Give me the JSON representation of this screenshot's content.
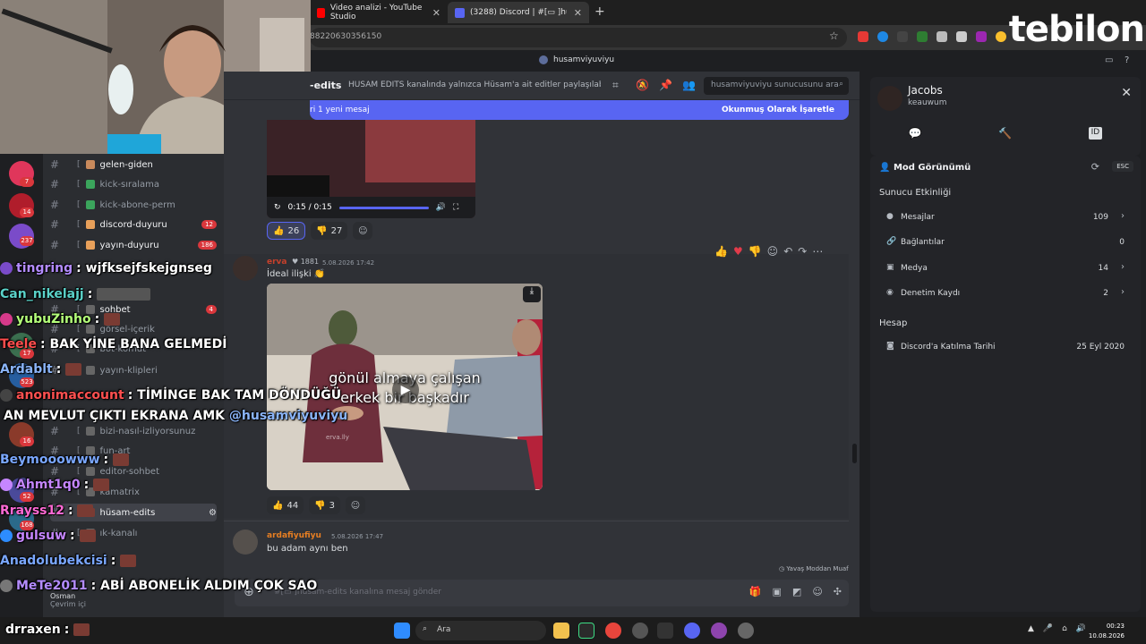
{
  "browser": {
    "tabs": [
      {
        "title": "Video analizi - YouTube Studio",
        "active": false
      },
      {
        "title": "(3288) Discord | #[▭ ]hüsam-e",
        "active": true
      }
    ],
    "url": "88220630356150",
    "logo": "tebilon"
  },
  "discord": {
    "server_name": "husamviyuviyu",
    "channel": {
      "name": "-edits",
      "topic": "HÜSAM EDİTS kanalında yalnızca Hüsam'a ait editler paylaşılabilir. H...",
      "search_placeholder": "husamviyuviyu sunucusunu ara"
    },
    "new_message_bar": {
      "left": "ri 1 yeni mesaj",
      "right": "Okunmuş Olarak İşaretle"
    },
    "video1": {
      "time": "0:15 / 0:15",
      "reactions": [
        {
          "emoji": "👍",
          "count": "26"
        },
        {
          "emoji": "👎",
          "count": "27"
        }
      ]
    },
    "message1": {
      "author": "erva",
      "pill": "1881",
      "timestamp": "5.08.2026 17:42",
      "text": "İdeal ilişki 👏",
      "video_caption_line1": "gönül almaya çalışan",
      "video_caption_line2": "erkek bir başkadır",
      "watermark": "erva.lly",
      "reactions": [
        {
          "emoji": "👍",
          "count": "44"
        },
        {
          "emoji": "👎",
          "count": "3"
        }
      ]
    },
    "message2": {
      "author": "ardafiyufiyu",
      "timestamp": "5.08.2026 17:47",
      "text": "bu adam aynı ben"
    },
    "slowmode": "Yavaş Moddan Muaf",
    "composer_placeholder": "#[▭ ]hüsam-edits kanalına mesaj gönder",
    "channels": [
      {
        "name": "gelen-giden",
        "badge": ""
      },
      {
        "name": "kick-sıralama",
        "badge": ""
      },
      {
        "name": "kick-abone-perm",
        "badge": ""
      },
      {
        "name": "discord-duyuru",
        "badge": "12"
      },
      {
        "name": "yayın-duyuru",
        "badge": "186"
      },
      {
        "name": "sohbet",
        "badge": "4"
      },
      {
        "name": "görsel-içerik",
        "badge": ""
      },
      {
        "name": "bot-komut",
        "badge": ""
      },
      {
        "name": "yayın-klipleri",
        "badge": ""
      },
      {
        "name": "bizi-nasıl-izliyorsunuz",
        "badge": ""
      },
      {
        "name": "fun-art",
        "badge": ""
      },
      {
        "name": "editor-sohbet",
        "badge": ""
      },
      {
        "name": "kamatrix",
        "badge": ""
      },
      {
        "name": "hüsam-edits",
        "badge": ""
      },
      {
        "name": "ık-kanalı",
        "badge": ""
      }
    ],
    "server_badges": [
      "7",
      "14",
      "237",
      "17",
      "523",
      "16",
      "52",
      "168"
    ],
    "user_status": "Çevrim içi",
    "user_name": "Osman"
  },
  "right_panel": {
    "display_name": "Jacobs",
    "username": "keauwum",
    "mod_view": "Mod Görünümü",
    "esc": "ESC",
    "activity_title": "Sunucu Etkinliği",
    "rows": [
      {
        "label": "Mesajlar",
        "value": "109"
      },
      {
        "label": "Bağlantılar",
        "value": "0"
      },
      {
        "label": "Medya",
        "value": "14"
      },
      {
        "label": "Denetim Kaydı",
        "value": "2"
      }
    ],
    "account_title": "Hesap",
    "account_row": {
      "label": "Discord'a Katılma Tarihi",
      "value": "25 Eyl 2020"
    }
  },
  "chat_overlay": [
    {
      "user": "tingring",
      "color": "#b48cff",
      "text": ": wjfksejfskejgnseg"
    },
    {
      "user": "Can_nikelajj",
      "color": "#5ad1c8",
      "text": ":"
    },
    {
      "user": "yubuZinho",
      "color": "#b4ff7a",
      "text": ":"
    },
    {
      "user": "Teele",
      "color": "#ff4d4d",
      "text": ": BAK YİNE BANA GELMEDİ"
    },
    {
      "user": "Ardablt",
      "color": "#8ab4f8",
      "text": ":"
    },
    {
      "user": "anonimaccount",
      "color": "#ff5050",
      "text": ": TİMİNGE BAK TAM DÖNDÜĞÜ"
    },
    {
      "user": "",
      "color": "#ffffff",
      "text": "AN MEVLUT ÇIKTI EKRANA AMK",
      "mention": "@husamviyuviyu"
    },
    {
      "user": "Beymooowww",
      "color": "#7aa7ff",
      "text": ":"
    },
    {
      "user": "Ahmt1q0",
      "color": "#c586ff",
      "text": ":"
    },
    {
      "user": "Rrayss12",
      "color": "#ff6ad5",
      "text": ":"
    },
    {
      "user": "gulsuw",
      "color": "#c586ff",
      "text": ":"
    },
    {
      "user": "Anadolubekcisi",
      "color": "#7aa7ff",
      "text": ":"
    },
    {
      "user": "MeTe2011",
      "color": "#b48cff",
      "text": ": ABİ ABONELİK ALDIM ÇOK SAO"
    },
    {
      "user": "drraxen",
      "color": "#ffffff",
      "text": ":"
    }
  ],
  "taskbar": {
    "search": "Ara",
    "time": "00:23",
    "date": "10.08.2026"
  }
}
